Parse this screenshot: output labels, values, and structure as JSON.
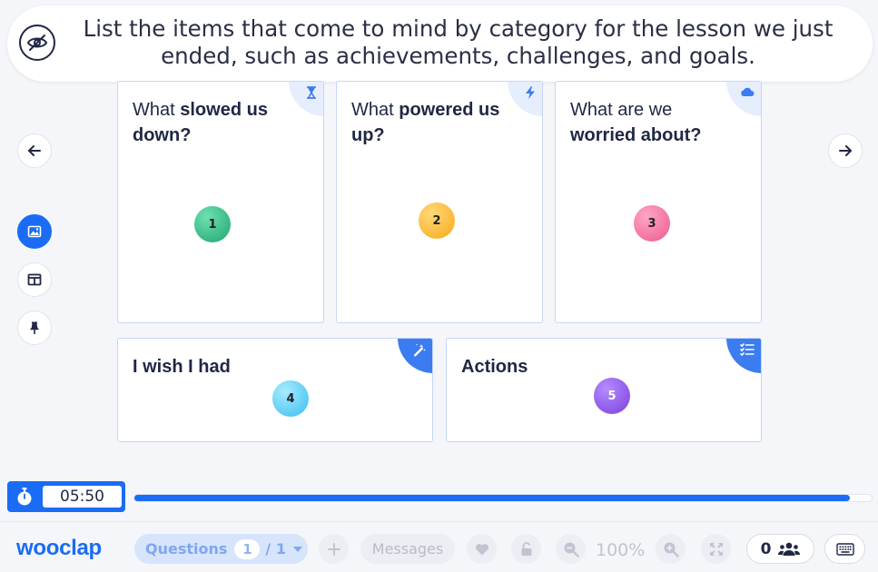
{
  "question": {
    "text": "List the items that come to mind by category for the lesson we just ended, such as  achievements, challenges, and goals."
  },
  "cards": [
    {
      "title_pre": "What ",
      "title_bold": "slowed us down?",
      "number": "1",
      "icon": "hourglass-icon",
      "dot_color": "#2eb87f"
    },
    {
      "title_pre": "What ",
      "title_bold": "powered us up?",
      "number": "2",
      "icon": "lightning-icon",
      "dot_color": "#fbb92a"
    },
    {
      "title_pre": "What are we ",
      "title_bold": "worried about?",
      "number": "3",
      "icon": "cloud-icon",
      "dot_color": "#ef6b9a"
    },
    {
      "title": "I wish I had",
      "number": "4",
      "icon": "magic-wand-icon",
      "dot_color": "#56ccf5"
    },
    {
      "title": "Actions",
      "number": "5",
      "icon": "checklist-icon",
      "dot_color": "#8a4fe3"
    }
  ],
  "timer": {
    "value": "05:50",
    "progress": 0.97
  },
  "bottom_bar": {
    "logo": "wooclap",
    "questions_label": "Questions",
    "question_current": "1",
    "question_total": "/ 1",
    "messages_label": "Messages",
    "zoom": "100%",
    "participants": "0"
  },
  "colors": {
    "accent": "#1a6cf5",
    "card_border": "#c5d6f5"
  }
}
